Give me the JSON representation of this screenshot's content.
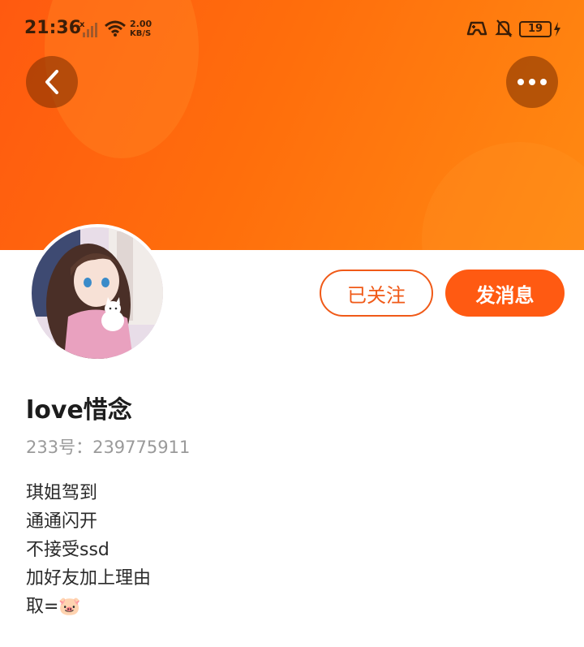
{
  "status_bar": {
    "time": "21:36",
    "net_speed_value": "2.00",
    "net_speed_unit": "KB/S",
    "battery_level": "19"
  },
  "header": {
    "accent_color": "#ff6a10"
  },
  "actions": {
    "followed_label": "已关注",
    "message_label": "发消息"
  },
  "profile": {
    "username": "love惜念",
    "id_line": "233号：239775911",
    "bio_lines": [
      "琪姐驾到",
      "通通闪开",
      "不接受ssd",
      "加好友加上理由",
      "取=🐷"
    ]
  }
}
